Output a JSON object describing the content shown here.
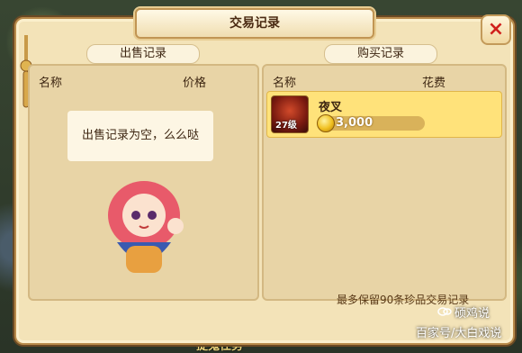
{
  "dialog": {
    "title": "交易记录",
    "close_label": "×"
  },
  "sell_panel": {
    "tab_label": "出售记录",
    "col_name": "名称",
    "col_price": "价格",
    "empty_message": "出售记录为空，么么哒"
  },
  "buy_panel": {
    "tab_label": "购买记录",
    "col_name": "名称",
    "col_cost": "花费",
    "items": [
      {
        "name": "夜叉",
        "level": "27级",
        "price": "3,000",
        "icon": "yaksha-pet-icon"
      }
    ]
  },
  "footer_note": "最多保留90条珍品交易记录",
  "background": {
    "bottom_hint": "捉鬼任务",
    "watermark_brand": "硕鸡说",
    "watermark_text": "百家号/大白戏说"
  },
  "colors": {
    "dialog_bg": "#f3e3b8",
    "highlight_row": "#ffe27a",
    "close_x": "#d0201c"
  }
}
